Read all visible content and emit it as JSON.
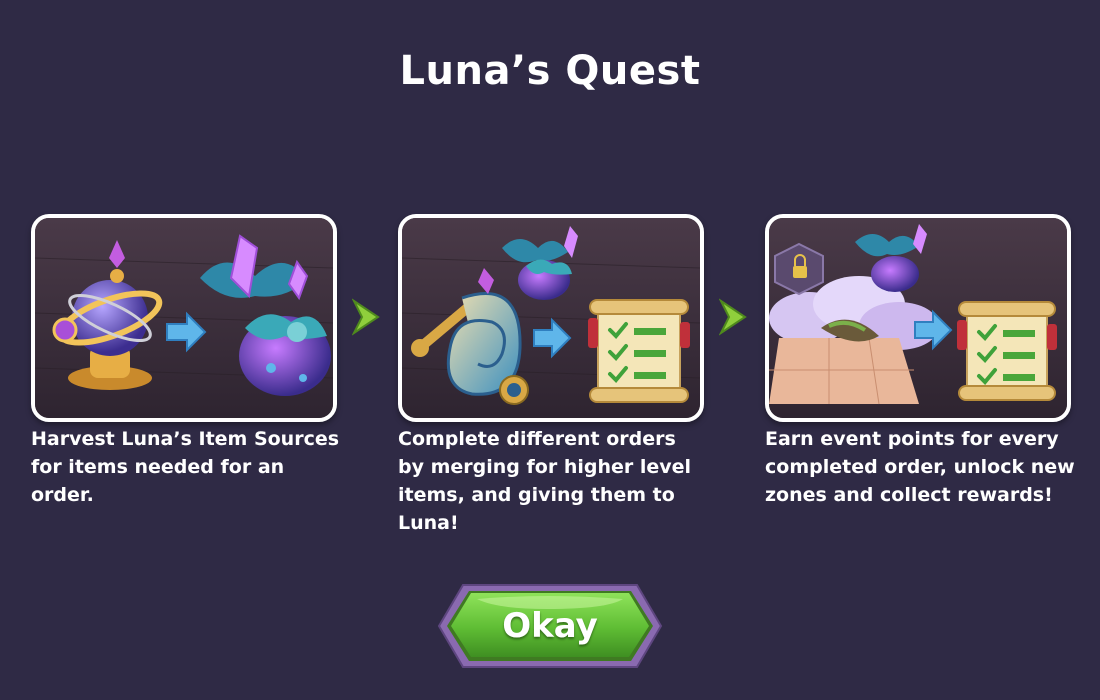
{
  "dialog": {
    "title": "Luna’s Quest",
    "steps": [
      {
        "caption": "Harvest Luna’s Item Sources for items needed for an order.",
        "illustration": "orrery-source-to-crystal-flower"
      },
      {
        "caption": "Complete different orders by merging for higher level items, and giving them to Luna!",
        "illustration": "merged-items-to-order-scroll"
      },
      {
        "caption": "Earn event points for every completed order, unlock new zones and collect rewards!",
        "illustration": "zones-to-order-scroll"
      }
    ],
    "step_arrow_icon": "chevron-right-icon",
    "okay_button": "Okay"
  },
  "colors": {
    "background": "#2f2a45",
    "card_border": "#ffffff",
    "card_inner": "#3d3040",
    "button_green": "#6cc93a",
    "button_rim": "#8a6ab0",
    "arrow_green": "#8fcf3c",
    "flow_arrow_blue": "#5fb6ea"
  }
}
